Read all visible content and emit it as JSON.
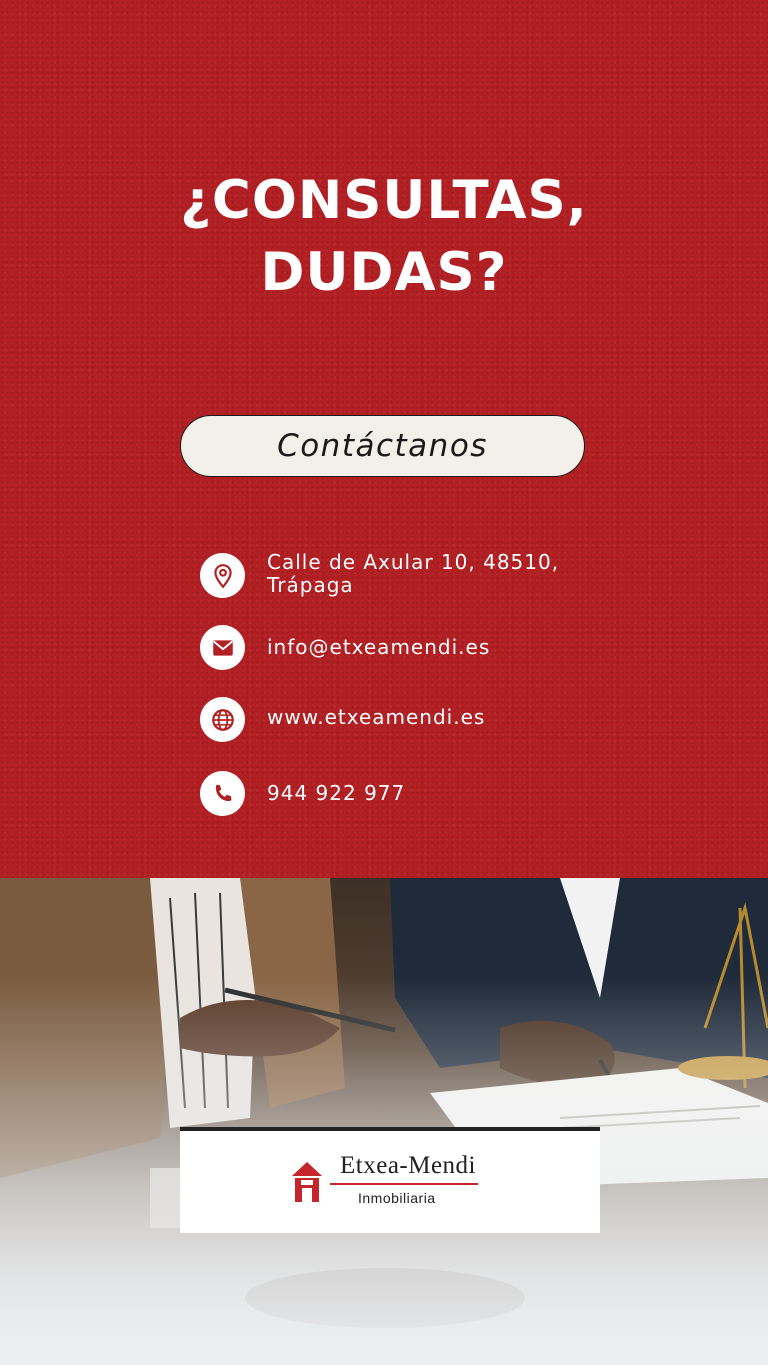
{
  "headline": {
    "line1": "¿CONSULTAS,",
    "line2": "DUDAS?"
  },
  "cta": {
    "label": "Contáctanos"
  },
  "contacts": [
    {
      "icon": "location-pin-icon",
      "line1": "Calle de Axular 10, 48510,",
      "line2": "Trápaga"
    },
    {
      "icon": "mail-icon",
      "text": "info@etxeamendi.es"
    },
    {
      "icon": "globe-icon",
      "text": "www.etxeamendi.es"
    },
    {
      "icon": "phone-icon",
      "text": "944 922 977"
    }
  ],
  "logo": {
    "name": "Etxea-Mendi",
    "subtitle": "Inmobiliaria"
  },
  "colors": {
    "brand_red": "#b32024",
    "button_bg": "#f3efe9"
  }
}
